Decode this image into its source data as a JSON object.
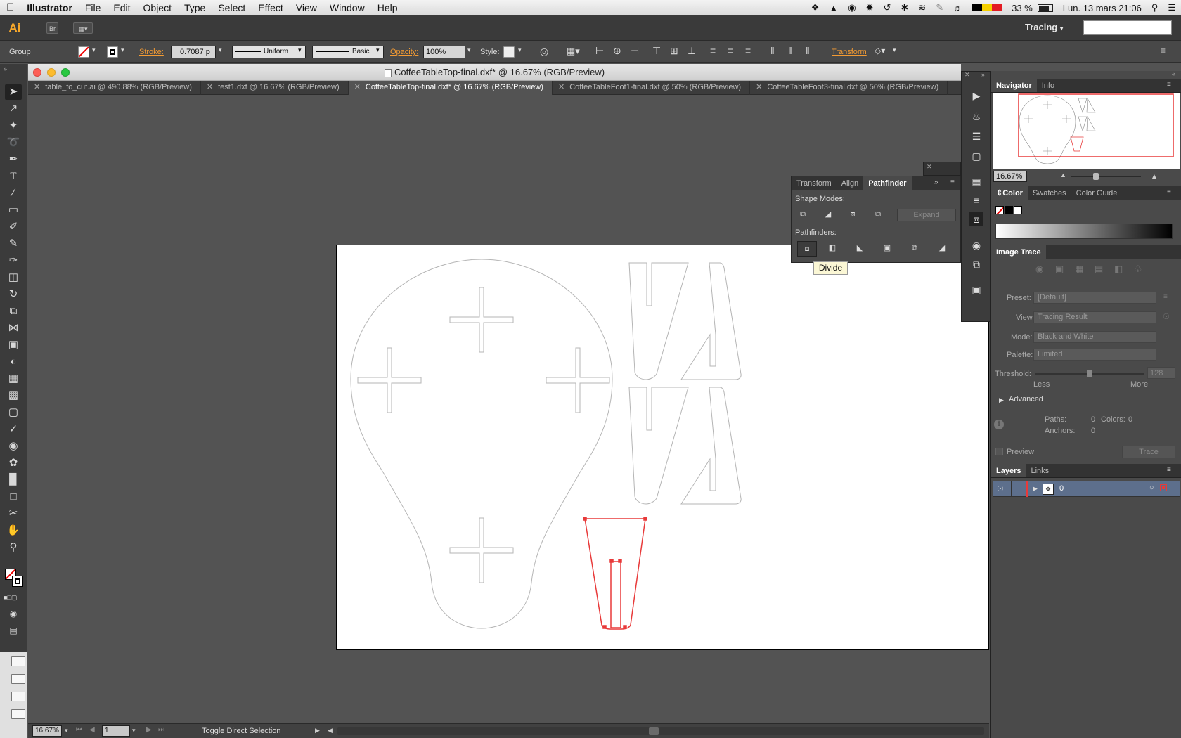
{
  "menubar": {
    "apple": "",
    "app_name": "Illustrator",
    "items": [
      "File",
      "Edit",
      "Object",
      "Type",
      "Select",
      "Effect",
      "View",
      "Window",
      "Help"
    ],
    "battery": "33 %",
    "datetime": "Lun. 13 mars  21:06"
  },
  "appbar": {
    "logo": "Ai",
    "bridge": "Br",
    "workspace": "Tracing",
    "workspace_arrow": "▾"
  },
  "control": {
    "selection_type": "Group",
    "stroke_label": "Stroke:",
    "stroke_value": "0.7087 p",
    "uniform": "Uniform",
    "basic": "Basic",
    "opacity_label": "Opacity:",
    "opacity_value": "100%",
    "style_label": "Style:",
    "transform_label": "Transform"
  },
  "document": {
    "window_title": "CoffeeTableTop-final.dxf* @ 16.67% (RGB/Preview)",
    "tabs": [
      {
        "label": "table_to_cut.ai @ 490.88% (RGB/Preview)",
        "active": false
      },
      {
        "label": "test1.dxf @ 16.67% (RGB/Preview)",
        "active": false
      },
      {
        "label": "CoffeeTableTop-final.dxf* @ 16.67% (RGB/Preview)",
        "active": true
      },
      {
        "label": "CoffeeTableFoot1-final.dxf @ 50% (RGB/Preview)",
        "active": false
      },
      {
        "label": "CoffeeTableFoot3-final.dxf @ 50% (RGB/Preview)",
        "active": false
      }
    ]
  },
  "status": {
    "zoom": "16.67%",
    "page": "1",
    "message": "Toggle Direct Selection"
  },
  "pathfinder_panel": {
    "tabs": [
      "Transform",
      "Align",
      "Pathfinder"
    ],
    "shape_modes_label": "Shape Modes:",
    "expand_label": "Expand",
    "pathfinders_label": "Pathfinders:",
    "tooltip": "Divide"
  },
  "navigator": {
    "tabs": [
      "Navigator",
      "Info"
    ],
    "zoom": "16.67%"
  },
  "color_panel": {
    "tabs": [
      "Color",
      "Swatches",
      "Color Guide"
    ]
  },
  "image_trace": {
    "title": "Image Trace",
    "preset_label": "Preset:",
    "preset_value": "[Default]",
    "view_label": "View:",
    "view_value": "Tracing Result",
    "mode_label": "Mode:",
    "mode_value": "Black and White",
    "palette_label": "Palette:",
    "palette_value": "Limited",
    "threshold_label": "Threshold:",
    "threshold_value": "128",
    "threshold_fraction": 0.5,
    "less": "Less",
    "more": "More",
    "advanced": "Advanced",
    "paths_label": "Paths:",
    "paths_value": "0",
    "colors_label": "Colors:",
    "colors_value": "0",
    "anchors_label": "Anchors:",
    "anchors_value": "0",
    "preview_label": "Preview",
    "trace_label": "Trace"
  },
  "layers_panel": {
    "tabs": [
      "Layers",
      "Links"
    ],
    "layer_name": "0"
  },
  "colors": {
    "accent_orange": "#f49b33",
    "selection_red": "#e83a3a"
  }
}
